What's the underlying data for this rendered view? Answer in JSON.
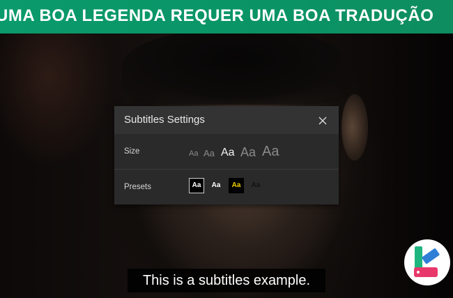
{
  "banner": {
    "text": "UMA BOA LEGENDA REQUER UMA BOA TRADUÇÃO"
  },
  "dialog": {
    "title": "Subtitles Settings",
    "close_icon": "close-icon",
    "size": {
      "label": "Size",
      "options": [
        "Aa",
        "Aa",
        "Aa",
        "Aa",
        "Aa"
      ],
      "selected_index": 2
    },
    "presets": {
      "label": "Presets",
      "options": [
        "Aa",
        "Aa",
        "Aa",
        "Aa"
      ],
      "selected_index": 0
    }
  },
  "subtitle": {
    "text": "This is a subtitles example."
  },
  "logo": {
    "icon": "app-logo-icon"
  },
  "colors": {
    "banner": "#0a9a6b",
    "dialog_bg": "#2a2a2b",
    "dialog_header": "#333334",
    "preset_yellow": "#f3d000",
    "logo_green": "#1fb57f",
    "logo_blue": "#2f7fd6",
    "logo_pink": "#e8386b"
  }
}
